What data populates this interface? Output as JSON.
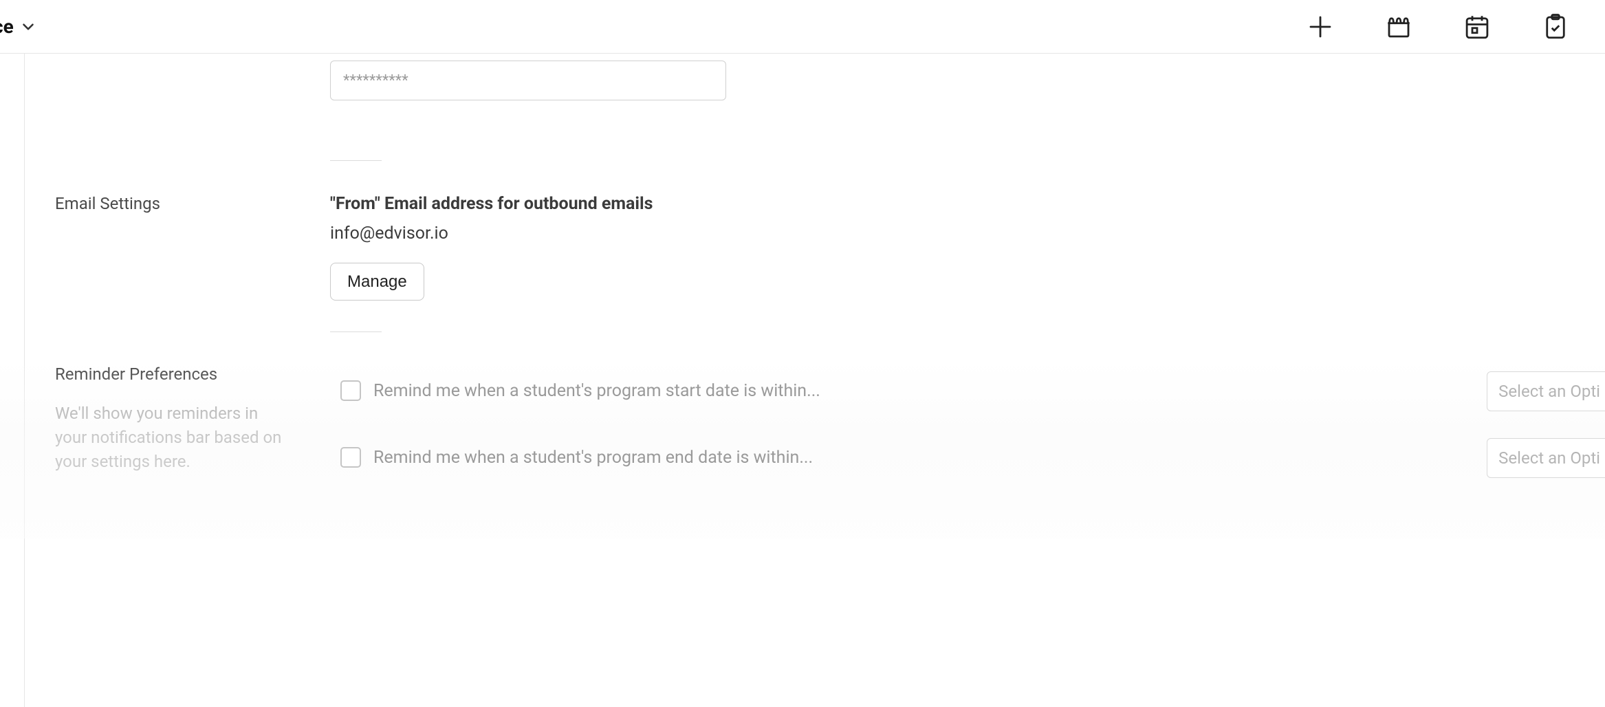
{
  "topbar": {
    "left_label_fragment": "ce"
  },
  "password": {
    "masked_value": "**********"
  },
  "email_settings": {
    "section_label": "Email Settings",
    "heading": "\"From\" Email address for outbound emails",
    "value": "info@edvisor.io",
    "manage_label": "Manage"
  },
  "reminders": {
    "section_label": "Reminder Preferences",
    "description": "We'll show you reminders in your notifications bar based on your settings here.",
    "items": [
      {
        "label": "Remind me when a student's program start date is within...",
        "select_placeholder": "Select an Opti"
      },
      {
        "label": "Remind me when a student's program end date is within...",
        "select_placeholder": "Select an Opti"
      }
    ]
  }
}
